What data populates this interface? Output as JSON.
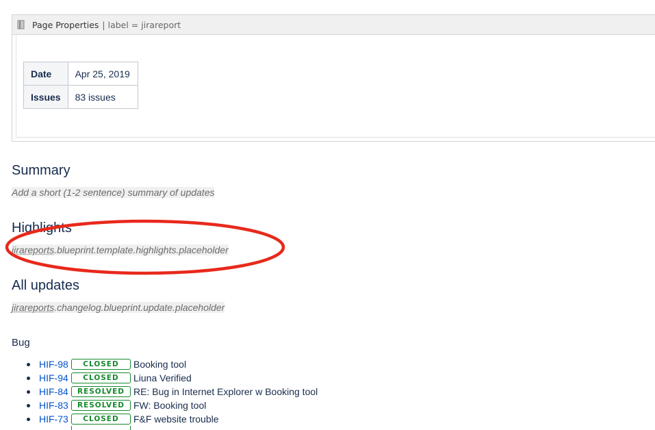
{
  "page_properties": {
    "title": "Page Properties",
    "params": "| label = jirareport",
    "rows": [
      {
        "key": "Date",
        "value": "Apr 25, 2019"
      },
      {
        "key": "Issues",
        "value": "83 issues"
      }
    ]
  },
  "summary": {
    "heading": "Summary",
    "placeholder": "Add a short (1-2 sentence) summary of updates"
  },
  "highlights": {
    "heading": "Highlights",
    "placeholder_prefix": "jirareports",
    "placeholder_rest": ".blueprint.template.highlights.placeholder"
  },
  "all_updates": {
    "heading": "All updates",
    "placeholder_prefix": "jirareports",
    "placeholder_rest": ".changelog.blueprint.update.placeholder"
  },
  "bug_section": {
    "heading": "Bug",
    "issues": [
      {
        "key": "HIF-98",
        "status": "CLOSED",
        "summary": "Booking tool"
      },
      {
        "key": "HIF-94",
        "status": "CLOSED",
        "summary": "Liuna Verified"
      },
      {
        "key": "HIF-84",
        "status": "RESOLVED",
        "summary": "RE: Bug in Internet Explorer w Booking tool"
      },
      {
        "key": "HIF-83",
        "status": "RESOLVED",
        "summary": "FW: Booking tool"
      },
      {
        "key": "HIF-73",
        "status": "CLOSED",
        "summary": "F&F website trouble"
      }
    ]
  },
  "colors": {
    "link": "#0052cc",
    "status_green": "#14892c",
    "annotation_red": "#e8291c"
  },
  "icons": {
    "macro": "page-properties-icon"
  }
}
